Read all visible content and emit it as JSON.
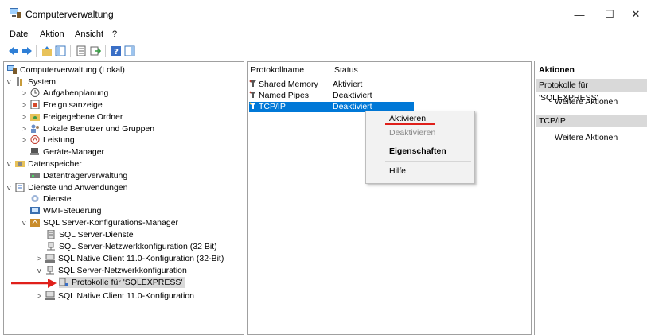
{
  "window": {
    "title": "Computerverwaltung",
    "minimize_glyph": "—",
    "maximize_glyph": "☐",
    "close_glyph": "✕"
  },
  "menu": [
    "Datei",
    "Aktion",
    "Ansicht",
    "?"
  ],
  "tree": [
    {
      "label": "Computerverwaltung (Lokal)",
      "icon": "computer-management-icon"
    },
    {
      "label": "System",
      "icon": "system-tools-icon"
    },
    {
      "label": "Aufgabenplanung",
      "icon": "task-scheduler-icon"
    },
    {
      "label": "Ereignisanzeige",
      "icon": "event-viewer-icon"
    },
    {
      "label": "Freigegebene Ordner",
      "icon": "shared-folders-icon"
    },
    {
      "label": "Lokale Benutzer und Gruppen",
      "icon": "users-icon"
    },
    {
      "label": "Leistung",
      "icon": "performance-icon"
    },
    {
      "label": "Geräte-Manager",
      "icon": "device-manager-icon"
    },
    {
      "label": "Datenspeicher",
      "icon": "storage-icon"
    },
    {
      "label": "Datenträgerverwaltung",
      "icon": "disk-management-icon"
    },
    {
      "label": "Dienste und Anwendungen",
      "icon": "services-apps-icon"
    },
    {
      "label": "Dienste",
      "icon": "services-icon"
    },
    {
      "label": "WMI-Steuerung",
      "icon": "wmi-icon"
    },
    {
      "label": "SQL Server-Konfigurations-Manager",
      "icon": "sql-config-icon"
    },
    {
      "label": "SQL Server-Dienste",
      "icon": "sql-services-icon"
    },
    {
      "label": "SQL Server-Netzwerkkonfiguration (32 Bit)",
      "icon": "network-config-icon"
    },
    {
      "label": "SQL Native Client 11.0-Konfiguration (32-Bit)",
      "icon": "native-client-icon"
    },
    {
      "label": "SQL Server-Netzwerkkonfiguration",
      "icon": "network-config-icon"
    },
    {
      "label": "Protokolle für 'SQLEXPRESS'",
      "icon": "protocols-icon"
    },
    {
      "label": "SQL Native Client 11.0-Konfiguration",
      "icon": "native-client-icon"
    }
  ],
  "list": {
    "col_name": "Protokollname",
    "col_status": "Status",
    "rows": [
      {
        "name": "Shared Memory",
        "status": "Aktiviert"
      },
      {
        "name": "Named Pipes",
        "status": "Deaktiviert"
      },
      {
        "name": "TCP/IP",
        "status": "Deaktiviert"
      }
    ]
  },
  "context_menu": {
    "enable": "Aktivieren",
    "disable": "Deaktivieren",
    "properties": "Eigenschaften",
    "help": "Hilfe"
  },
  "actions": {
    "header": "Aktionen",
    "section1": "Protokolle für 'SQLEXPRESS'",
    "link1": "Weitere Aktionen",
    "section2": "TCP/IP",
    "link2": "Weitere Aktionen"
  },
  "colors": {
    "selection": "#0078d7",
    "annotation": "#e0201b"
  }
}
